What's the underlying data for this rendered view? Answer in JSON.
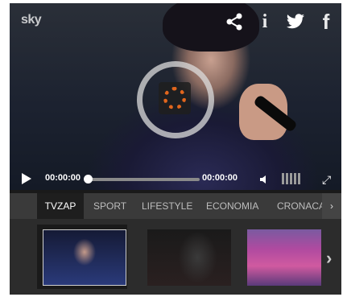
{
  "player": {
    "brand_logo": "sky",
    "share_icons": [
      {
        "icon": "share-icon",
        "glyph": "⋖"
      },
      {
        "icon": "info-icon",
        "glyph": "i"
      },
      {
        "icon": "twitter-icon",
        "glyph": "✦"
      },
      {
        "icon": "facebook-icon",
        "glyph": "f"
      }
    ],
    "current_time": "00:00:00",
    "duration": "00:00:00",
    "progress": 0,
    "fullscreen_glyph": "⤢",
    "loader_color": "#e2661d"
  },
  "tabs": {
    "items": [
      {
        "label": "TVZAP",
        "active": true
      },
      {
        "label": "SPORT",
        "active": false
      },
      {
        "label": "LIFESTYLE",
        "active": false
      },
      {
        "label": "ECONOMIA",
        "active": false
      },
      {
        "label": "CRONACA",
        "active": false
      }
    ],
    "next_glyph": "›"
  },
  "thumbnails": {
    "next_glyph": "›",
    "items": [
      {
        "name": "singer-performing-thumbnail",
        "active": true
      },
      {
        "name": "dark-stage-thumbnail",
        "active": false
      },
      {
        "name": "show-stage-thumbnail",
        "active": false
      }
    ]
  }
}
